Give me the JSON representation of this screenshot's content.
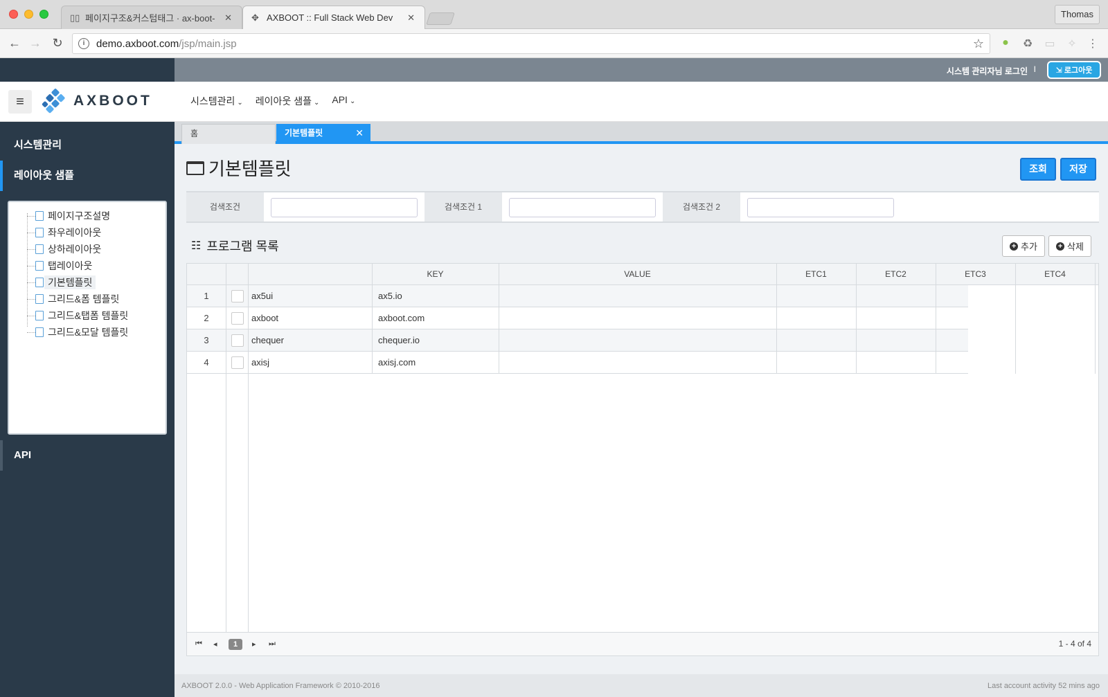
{
  "browser": {
    "tabs": [
      {
        "label": "페이지구조&커스텀태그 · ax-boot-",
        "icon": "book-icon"
      },
      {
        "label": "AXBOOT :: Full Stack Web Dev",
        "icon": "axboot-logo-icon"
      }
    ],
    "profile": "Thomas",
    "url_host": "demo.axboot.com",
    "url_path": "/jsp/main.jsp"
  },
  "topbar": {
    "login_text": "시스템 관리자님 로그인",
    "separator": "I",
    "logout_label": "로그아웃"
  },
  "header": {
    "logo_text": "AXBOOT",
    "menu": [
      "시스템관리",
      "레이아웃 샘플",
      "API"
    ]
  },
  "sidebar": {
    "items": [
      "시스템관리",
      "레이아웃 샘플",
      "API"
    ],
    "tree": [
      "페이지구조설명",
      "좌우레이아웃",
      "상하레이아웃",
      "탭레이아웃",
      "기본템플릿",
      "그리드&폼 템플릿",
      "그리드&탭폼 템플릿",
      "그리드&모달 템플릿"
    ],
    "tree_selected": "기본템플릿"
  },
  "content_tabs": {
    "home": "홈",
    "current": "기본템플릿",
    "close": "✕"
  },
  "page": {
    "title": "기본템플릿",
    "search_button": "조회",
    "save_button": "저장"
  },
  "search_form": {
    "labels": [
      "검색조건",
      "검색조건 1",
      "검색조건 2"
    ],
    "values": [
      "",
      "",
      ""
    ]
  },
  "list": {
    "title": "프로그램 목록",
    "add_button": "추가",
    "delete_button": "삭제"
  },
  "grid": {
    "columns": [
      "KEY",
      "VALUE",
      "ETC1",
      "ETC2",
      "ETC3",
      "ETC4"
    ],
    "rows": [
      {
        "no": "1",
        "key": "ax5ui",
        "value": "ax5.io"
      },
      {
        "no": "2",
        "key": "axboot",
        "value": "axboot.com"
      },
      {
        "no": "3",
        "key": "chequer",
        "value": "chequer.io"
      },
      {
        "no": "4",
        "key": "axisj",
        "value": "axisj.com"
      }
    ],
    "current_page": "1",
    "count_text": "1 - 4 of 4"
  },
  "footer": {
    "left": "AXBOOT 2.0.0 - Web Application Framework © 2010-2016",
    "right": "Last account activity 52 mins ago"
  },
  "colors": {
    "accent": "#2196f3",
    "sidebar_bg": "#2a3a49",
    "topstrip_bg": "#7b8691"
  }
}
